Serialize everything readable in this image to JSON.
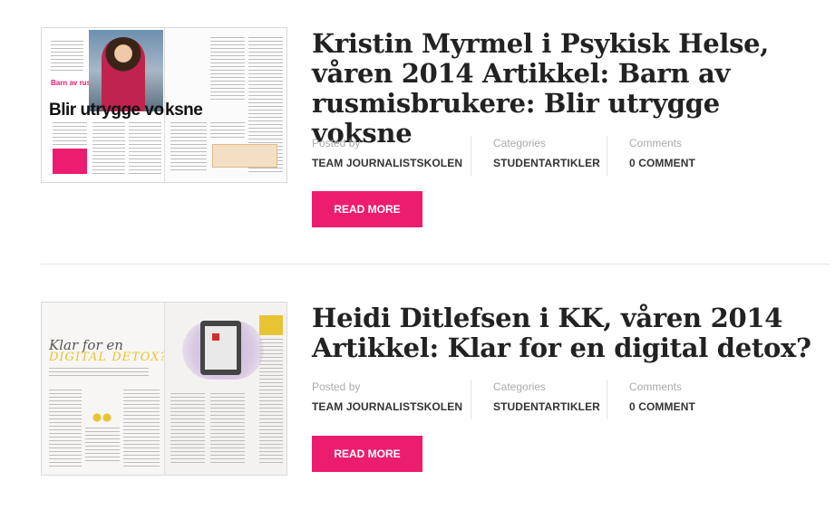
{
  "posts": [
    {
      "title": "Kristin Myrmel i Psykisk Helse, våren 2014 Artikkel: Barn av rusmisbrukere: Blir utrygge voksne",
      "meta": {
        "posted_by_label": "Posted by",
        "posted_by_value": "TEAM JOURNALISTSKOLEN",
        "categories_label": "Categories",
        "categories_value": "STUDENTARTIKLER",
        "comments_label": "Comments",
        "comments_value": "0 COMMENT"
      },
      "read_more_label": "READ MORE",
      "thumbnail": {
        "pink_text": "Barn av rusmis- brukere:",
        "headline_left": "Blir utrygge vo",
        "headline_right": "ksne"
      }
    },
    {
      "title": "Heidi Ditlefsen i KK, våren 2014 Artikkel: Klar for en digital detox?",
      "meta": {
        "posted_by_label": "Posted by",
        "posted_by_value": "TEAM JOURNALISTSKOLEN",
        "categories_label": "Categories",
        "categories_value": "STUDENTARTIKLER",
        "comments_label": "Comments",
        "comments_value": "0 COMMENT"
      },
      "read_more_label": "READ MORE",
      "thumbnail": {
        "title_line1": "Klar for en",
        "title_line2": "DIGITAL DETOX?"
      }
    }
  ],
  "colors": {
    "accent": "#ec1c6f",
    "title": "#222222",
    "meta_label": "#aaaaaa",
    "meta_value": "#333333"
  }
}
